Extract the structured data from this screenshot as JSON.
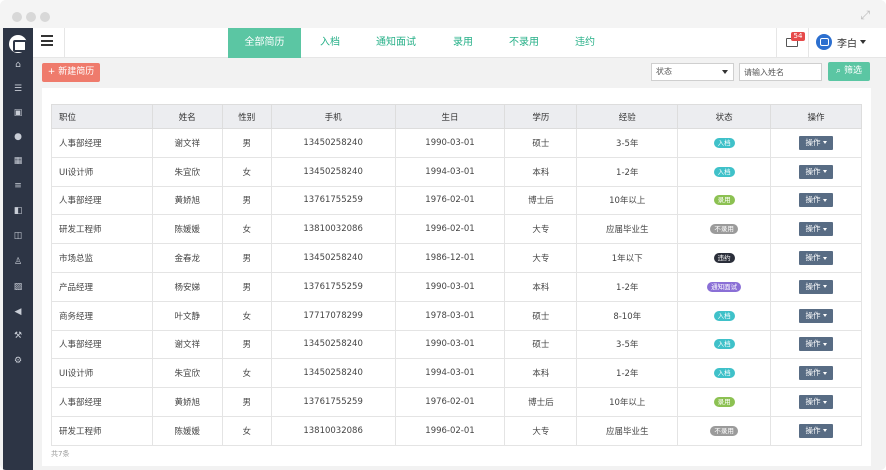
{
  "window": {
    "expand_glyph": "⤢"
  },
  "sidebar": {
    "icons": [
      "home-icon",
      "list-icon",
      "briefcase-icon",
      "users-icon",
      "calendar-icon",
      "tasks-icon",
      "book-icon",
      "columns-icon",
      "person-icon",
      "image-icon",
      "megaphone-icon",
      "gavel-icon",
      "cogs-icon"
    ]
  },
  "topbar": {
    "tabs": [
      {
        "label": "全部简历",
        "active": true
      },
      {
        "label": "入档",
        "active": false
      },
      {
        "label": "通知面试",
        "active": false
      },
      {
        "label": "录用",
        "active": false
      },
      {
        "label": "不录用",
        "active": false
      },
      {
        "label": "违约",
        "active": false
      }
    ],
    "mail_badge": "54",
    "username": "李白"
  },
  "toolbar": {
    "new_button": "新建简历",
    "status_select": "状态",
    "name_placeholder": "请输入姓名",
    "filter_button": "筛选"
  },
  "table": {
    "headers": [
      "职位",
      "姓名",
      "性别",
      "手机",
      "生日",
      "学历",
      "经验",
      "状态",
      "操作"
    ],
    "action_label": "操作",
    "rows": [
      {
        "position": "人事部经理",
        "name": "谢文祥",
        "gender": "男",
        "phone": "13450258240",
        "birthday": "1990-03-01",
        "education": "硕士",
        "experience": "3-5年",
        "status": "入档"
      },
      {
        "position": "UI设计师",
        "name": "朱宜欣",
        "gender": "女",
        "phone": "13450258240",
        "birthday": "1994-03-01",
        "education": "本科",
        "experience": "1-2年",
        "status": "入档"
      },
      {
        "position": "人事部经理",
        "name": "黄娇旭",
        "gender": "男",
        "phone": "13761755259",
        "birthday": "1976-02-01",
        "education": "博士后",
        "experience": "10年以上",
        "status": "录用"
      },
      {
        "position": "研发工程师",
        "name": "陈媛媛",
        "gender": "女",
        "phone": "13810032086",
        "birthday": "1996-02-01",
        "education": "大专",
        "experience": "应届毕业生",
        "status": "不录用"
      },
      {
        "position": "市场总监",
        "name": "金春龙",
        "gender": "男",
        "phone": "13450258240",
        "birthday": "1986-12-01",
        "education": "大专",
        "experience": "1年以下",
        "status": "违约"
      },
      {
        "position": "产品经理",
        "name": "杨安娣",
        "gender": "男",
        "phone": "13761755259",
        "birthday": "1990-03-01",
        "education": "本科",
        "experience": "1-2年",
        "status": "通知面试"
      },
      {
        "position": "商务经理",
        "name": "叶文静",
        "gender": "女",
        "phone": "17717078299",
        "birthday": "1978-03-01",
        "education": "硕士",
        "experience": "8-10年",
        "status": "入档"
      },
      {
        "position": "人事部经理",
        "name": "谢文祥",
        "gender": "男",
        "phone": "13450258240",
        "birthday": "1990-03-01",
        "education": "硕士",
        "experience": "3-5年",
        "status": "入档"
      },
      {
        "position": "UI设计师",
        "name": "朱宜欣",
        "gender": "女",
        "phone": "13450258240",
        "birthday": "1994-03-01",
        "education": "本科",
        "experience": "1-2年",
        "status": "入档"
      },
      {
        "position": "人事部经理",
        "name": "黄娇旭",
        "gender": "男",
        "phone": "13761755259",
        "birthday": "1976-02-01",
        "education": "博士后",
        "experience": "10年以上",
        "status": "录用"
      },
      {
        "position": "研发工程师",
        "name": "陈媛媛",
        "gender": "女",
        "phone": "13810032086",
        "birthday": "1996-02-01",
        "education": "大专",
        "experience": "应届毕业生",
        "status": "不录用"
      }
    ]
  },
  "status_colors": {
    "入档": "#3fc1c9",
    "录用": "#8cc152",
    "不录用": "#9b9b9b",
    "违约": "#2b2f3a",
    "通知面试": "#8a6fd6"
  },
  "footer": {
    "total": "共7条"
  },
  "colors": {
    "accent": "#5bc6a3",
    "new_button": "#ef7b6c",
    "sidebar": "#2d3545",
    "action_button": "#586c84"
  }
}
